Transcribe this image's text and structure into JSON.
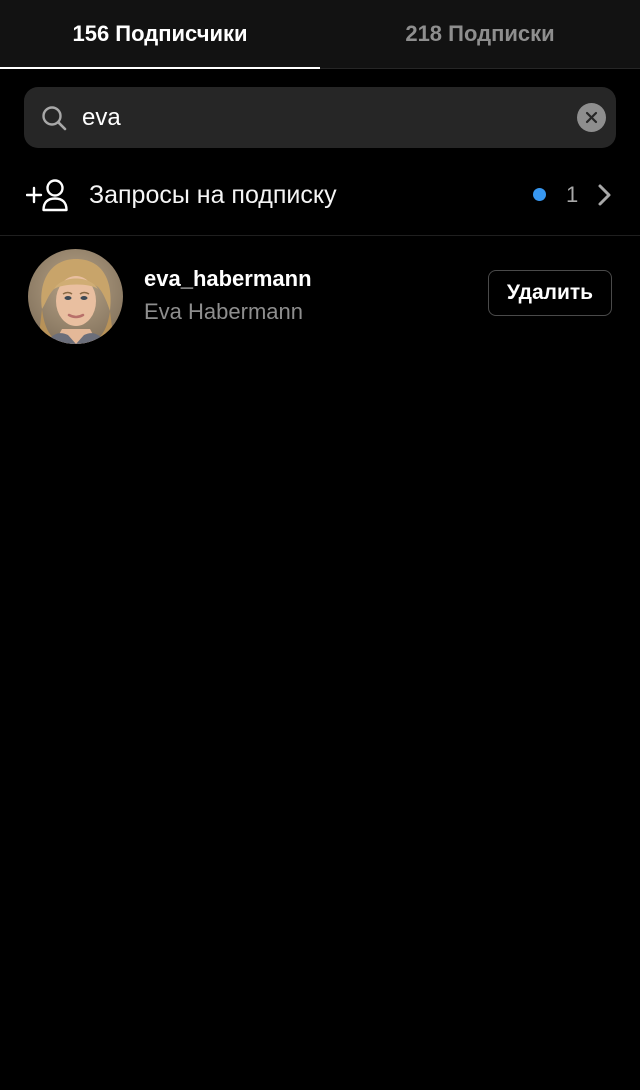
{
  "tabs": [
    {
      "label": "156 Подписчики",
      "active": true
    },
    {
      "label": "218 Подписки",
      "active": false
    }
  ],
  "search": {
    "value": "eva",
    "icon": "search-icon",
    "clear_icon": "close-icon"
  },
  "requests": {
    "icon": "add-user-icon",
    "label": "Запросы на подписку",
    "count": "1",
    "dot_color": "#3797f0",
    "chevron_icon": "chevron-right-icon"
  },
  "users": [
    {
      "username": "eva_habermann",
      "full_name": "Eva Habermann",
      "button_label": "Удалить"
    }
  ],
  "colors": {
    "background": "#000000",
    "tab_bar": "#121212",
    "search_bg": "#262626",
    "secondary_text": "#8e8e8e",
    "accent": "#3797f0"
  }
}
